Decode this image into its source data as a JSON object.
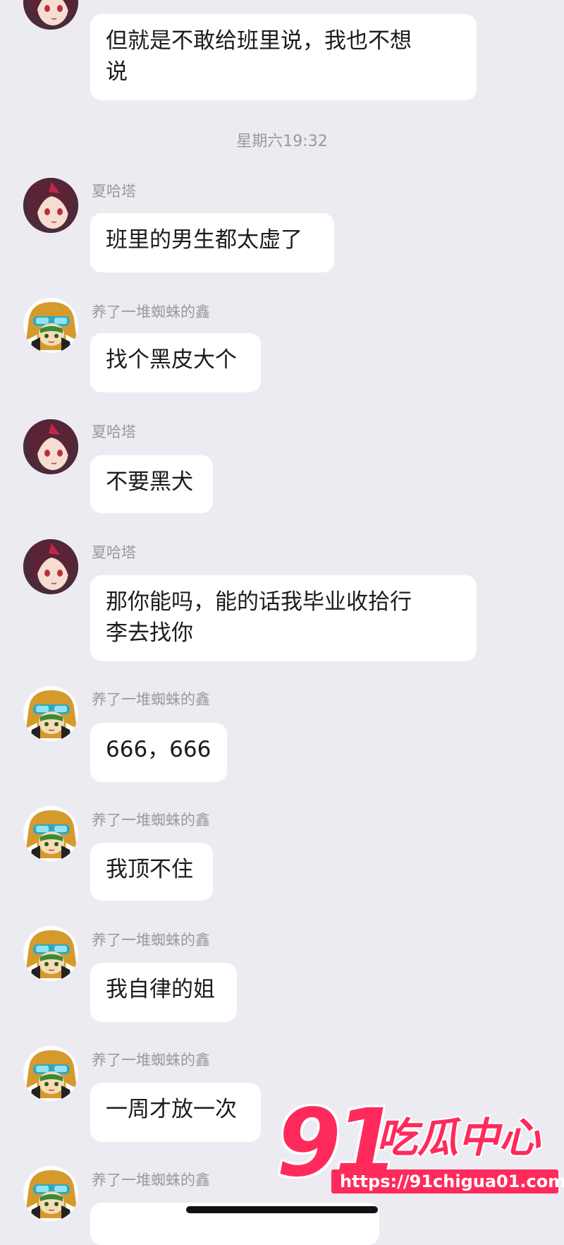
{
  "colors": {
    "background": "#edebf2",
    "bubble": "#ffffff",
    "watermark": "#ff2a5c"
  },
  "timestamp": "星期六19:32",
  "messages": [
    {
      "sender": "",
      "text": "但就是不敢给班里说，我也不想\n说",
      "avatar": "girl-avatar"
    },
    {
      "sender": "夏哈塔",
      "text": "班里的男生都太虚了",
      "avatar": "girl-avatar"
    },
    {
      "sender": "养了一堆蜘蛛的鑫",
      "text": "找个黑皮大个",
      "avatar": "boy-avatar"
    },
    {
      "sender": "夏哈塔",
      "text": "不要黑犬",
      "avatar": "girl-avatar"
    },
    {
      "sender": "夏哈塔",
      "text": "那你能吗，能的话我毕业收拾行\n李去找你",
      "avatar": "girl-avatar"
    },
    {
      "sender": "养了一堆蜘蛛的鑫",
      "text": "666，666",
      "avatar": "boy-avatar"
    },
    {
      "sender": "养了一堆蜘蛛的鑫",
      "text": "我顶不住",
      "avatar": "boy-avatar"
    },
    {
      "sender": "养了一堆蜘蛛的鑫",
      "text": "我自律的姐",
      "avatar": "boy-avatar"
    },
    {
      "sender": "养了一堆蜘蛛的鑫",
      "text": "一周才放一次",
      "avatar": "boy-avatar"
    },
    {
      "sender": "养了一堆蜘蛛的鑫",
      "text": "",
      "avatar": "boy-avatar"
    }
  ],
  "watermark": {
    "number": "91",
    "title": "吃瓜中心",
    "url": "https://91chigua01.com"
  }
}
